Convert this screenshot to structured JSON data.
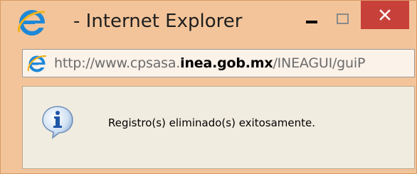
{
  "window": {
    "title": "- Internet Explorer",
    "accent_close": "#c8403a"
  },
  "address_bar": {
    "url_prefix": "http://www.cpsasa.",
    "url_host": "inea.gob.mx",
    "url_path": "/INEAGUI/guiP"
  },
  "dialog": {
    "message": "Registro(s) eliminado(s) exitosamente.",
    "icon": "info-icon"
  },
  "icons": {
    "browser": "internet-explorer-icon",
    "minimize": "minimize-icon",
    "maximize": "maximize-icon",
    "close": "close-icon"
  }
}
